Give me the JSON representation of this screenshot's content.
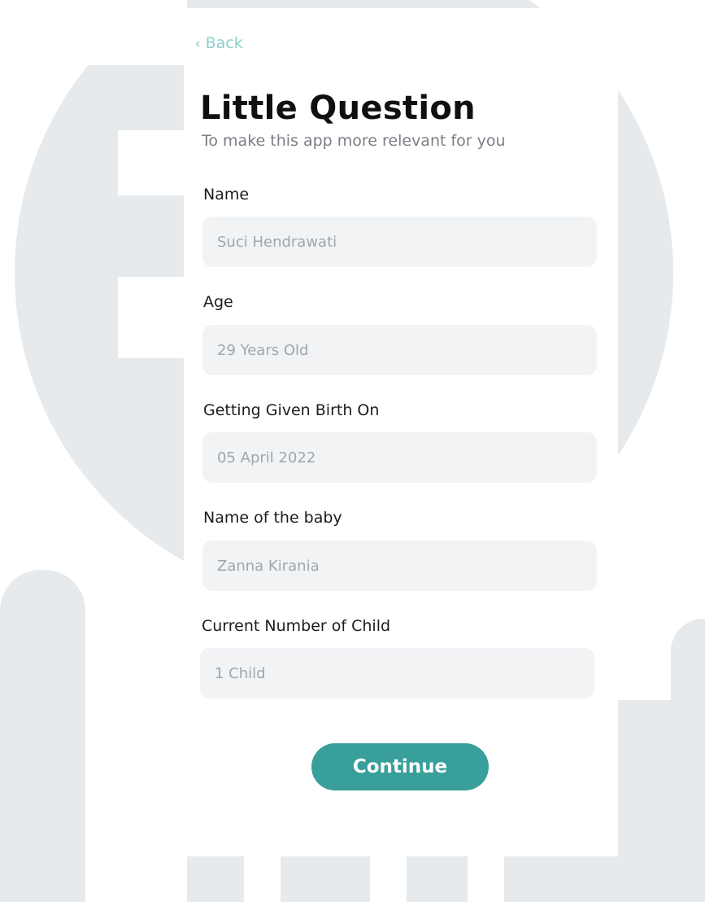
{
  "header": {
    "back_label": "Back",
    "title": "Little Question",
    "subtitle": "To make this app more relevant for you"
  },
  "form": {
    "fields": [
      {
        "label": "Name",
        "value": "Suci Hendrawati"
      },
      {
        "label": "Age",
        "value": "29 Years Old"
      },
      {
        "label": "Getting Given Birth On",
        "value": "05 April 2022"
      },
      {
        "label": "Name of the baby",
        "value": "Zanna Kirania"
      },
      {
        "label": "Current Number of Child",
        "value": "1 Child"
      }
    ]
  },
  "actions": {
    "continue_label": "Continue"
  },
  "colors": {
    "accent": "#389f9b",
    "back_link": "#8fcfc9",
    "input_bg": "#f1f3f5",
    "watermark": "#e6eaed"
  },
  "icons": {
    "back": "chevron-left-icon"
  }
}
